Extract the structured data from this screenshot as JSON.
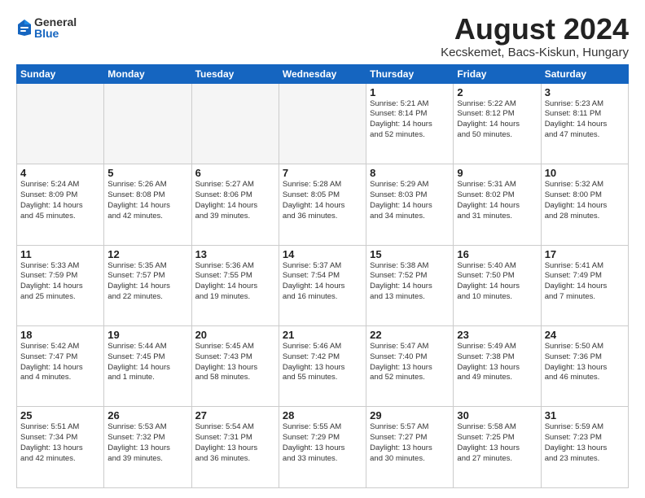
{
  "logo": {
    "general": "General",
    "blue": "Blue"
  },
  "title": "August 2024",
  "subtitle": "Kecskemet, Bacs-Kiskun, Hungary",
  "days_header": [
    "Sunday",
    "Monday",
    "Tuesday",
    "Wednesday",
    "Thursday",
    "Friday",
    "Saturday"
  ],
  "weeks": [
    [
      {
        "day": "",
        "info": ""
      },
      {
        "day": "",
        "info": ""
      },
      {
        "day": "",
        "info": ""
      },
      {
        "day": "",
        "info": ""
      },
      {
        "day": "1",
        "info": "Sunrise: 5:21 AM\nSunset: 8:14 PM\nDaylight: 14 hours\nand 52 minutes."
      },
      {
        "day": "2",
        "info": "Sunrise: 5:22 AM\nSunset: 8:12 PM\nDaylight: 14 hours\nand 50 minutes."
      },
      {
        "day": "3",
        "info": "Sunrise: 5:23 AM\nSunset: 8:11 PM\nDaylight: 14 hours\nand 47 minutes."
      }
    ],
    [
      {
        "day": "4",
        "info": "Sunrise: 5:24 AM\nSunset: 8:09 PM\nDaylight: 14 hours\nand 45 minutes."
      },
      {
        "day": "5",
        "info": "Sunrise: 5:26 AM\nSunset: 8:08 PM\nDaylight: 14 hours\nand 42 minutes."
      },
      {
        "day": "6",
        "info": "Sunrise: 5:27 AM\nSunset: 8:06 PM\nDaylight: 14 hours\nand 39 minutes."
      },
      {
        "day": "7",
        "info": "Sunrise: 5:28 AM\nSunset: 8:05 PM\nDaylight: 14 hours\nand 36 minutes."
      },
      {
        "day": "8",
        "info": "Sunrise: 5:29 AM\nSunset: 8:03 PM\nDaylight: 14 hours\nand 34 minutes."
      },
      {
        "day": "9",
        "info": "Sunrise: 5:31 AM\nSunset: 8:02 PM\nDaylight: 14 hours\nand 31 minutes."
      },
      {
        "day": "10",
        "info": "Sunrise: 5:32 AM\nSunset: 8:00 PM\nDaylight: 14 hours\nand 28 minutes."
      }
    ],
    [
      {
        "day": "11",
        "info": "Sunrise: 5:33 AM\nSunset: 7:59 PM\nDaylight: 14 hours\nand 25 minutes."
      },
      {
        "day": "12",
        "info": "Sunrise: 5:35 AM\nSunset: 7:57 PM\nDaylight: 14 hours\nand 22 minutes."
      },
      {
        "day": "13",
        "info": "Sunrise: 5:36 AM\nSunset: 7:55 PM\nDaylight: 14 hours\nand 19 minutes."
      },
      {
        "day": "14",
        "info": "Sunrise: 5:37 AM\nSunset: 7:54 PM\nDaylight: 14 hours\nand 16 minutes."
      },
      {
        "day": "15",
        "info": "Sunrise: 5:38 AM\nSunset: 7:52 PM\nDaylight: 14 hours\nand 13 minutes."
      },
      {
        "day": "16",
        "info": "Sunrise: 5:40 AM\nSunset: 7:50 PM\nDaylight: 14 hours\nand 10 minutes."
      },
      {
        "day": "17",
        "info": "Sunrise: 5:41 AM\nSunset: 7:49 PM\nDaylight: 14 hours\nand 7 minutes."
      }
    ],
    [
      {
        "day": "18",
        "info": "Sunrise: 5:42 AM\nSunset: 7:47 PM\nDaylight: 14 hours\nand 4 minutes."
      },
      {
        "day": "19",
        "info": "Sunrise: 5:44 AM\nSunset: 7:45 PM\nDaylight: 14 hours\nand 1 minute."
      },
      {
        "day": "20",
        "info": "Sunrise: 5:45 AM\nSunset: 7:43 PM\nDaylight: 13 hours\nand 58 minutes."
      },
      {
        "day": "21",
        "info": "Sunrise: 5:46 AM\nSunset: 7:42 PM\nDaylight: 13 hours\nand 55 minutes."
      },
      {
        "day": "22",
        "info": "Sunrise: 5:47 AM\nSunset: 7:40 PM\nDaylight: 13 hours\nand 52 minutes."
      },
      {
        "day": "23",
        "info": "Sunrise: 5:49 AM\nSunset: 7:38 PM\nDaylight: 13 hours\nand 49 minutes."
      },
      {
        "day": "24",
        "info": "Sunrise: 5:50 AM\nSunset: 7:36 PM\nDaylight: 13 hours\nand 46 minutes."
      }
    ],
    [
      {
        "day": "25",
        "info": "Sunrise: 5:51 AM\nSunset: 7:34 PM\nDaylight: 13 hours\nand 42 minutes."
      },
      {
        "day": "26",
        "info": "Sunrise: 5:53 AM\nSunset: 7:32 PM\nDaylight: 13 hours\nand 39 minutes."
      },
      {
        "day": "27",
        "info": "Sunrise: 5:54 AM\nSunset: 7:31 PM\nDaylight: 13 hours\nand 36 minutes."
      },
      {
        "day": "28",
        "info": "Sunrise: 5:55 AM\nSunset: 7:29 PM\nDaylight: 13 hours\nand 33 minutes."
      },
      {
        "day": "29",
        "info": "Sunrise: 5:57 AM\nSunset: 7:27 PM\nDaylight: 13 hours\nand 30 minutes."
      },
      {
        "day": "30",
        "info": "Sunrise: 5:58 AM\nSunset: 7:25 PM\nDaylight: 13 hours\nand 27 minutes."
      },
      {
        "day": "31",
        "info": "Sunrise: 5:59 AM\nSunset: 7:23 PM\nDaylight: 13 hours\nand 23 minutes."
      }
    ]
  ]
}
